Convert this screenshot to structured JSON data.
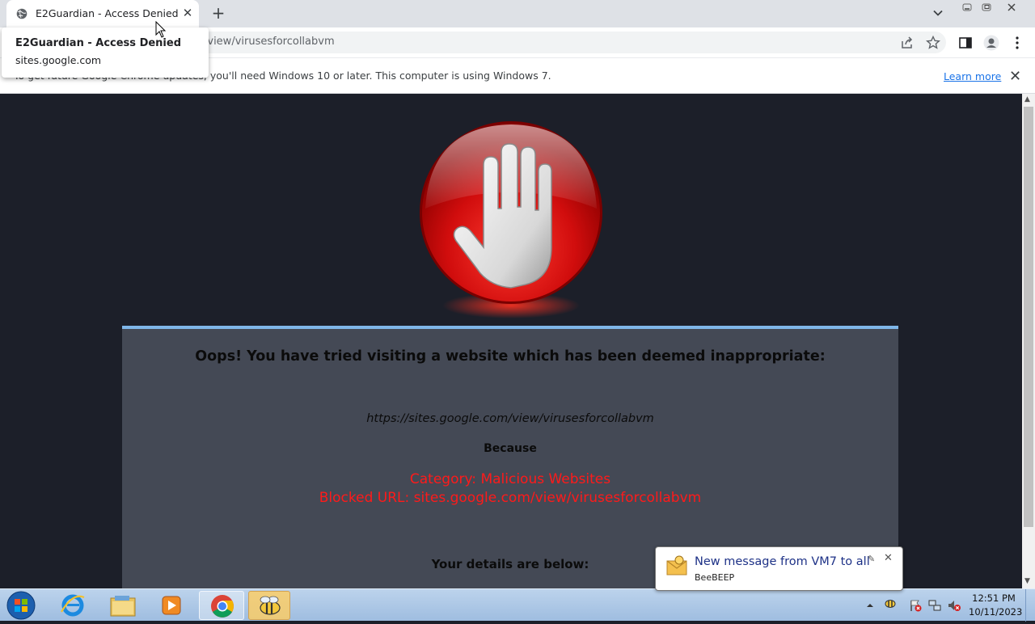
{
  "browser": {
    "tab_title": "E2Guardian - Access Denied",
    "tab_close": "✕",
    "new_tab": "+",
    "url": "/view/virusesforcollabvm",
    "tooltip": {
      "title": "E2Guardian - Access Denied",
      "url": "sites.google.com"
    },
    "infobar": {
      "text": "To get future Google Chrome updates, you'll need Windows 10 or later. This computer is using Windows 7.",
      "learn_more": "Learn more",
      "close": "✕"
    }
  },
  "page": {
    "heading": "Oops! You have tried visiting a website which has been deemed inappropriate:",
    "blocked_url": "https://sites.google.com/view/virusesforcollabvm",
    "because": "Because",
    "category": "Category: Malicious Websites",
    "blocked_line": "Blocked URL: sites.google.com/view/virusesforcollabvm",
    "details": "Your details are below:"
  },
  "notification": {
    "title": "New message from VM7 to all",
    "app": "BeeBEEP",
    "close": "✕"
  },
  "taskbar": {
    "time": "12:51 PM",
    "date": "10/11/2023"
  },
  "colors": {
    "page_bg": "#1c1f29",
    "panel_bg": "#444955",
    "panel_border": "#7fb6e8",
    "alert_text": "#ff1a1a"
  }
}
